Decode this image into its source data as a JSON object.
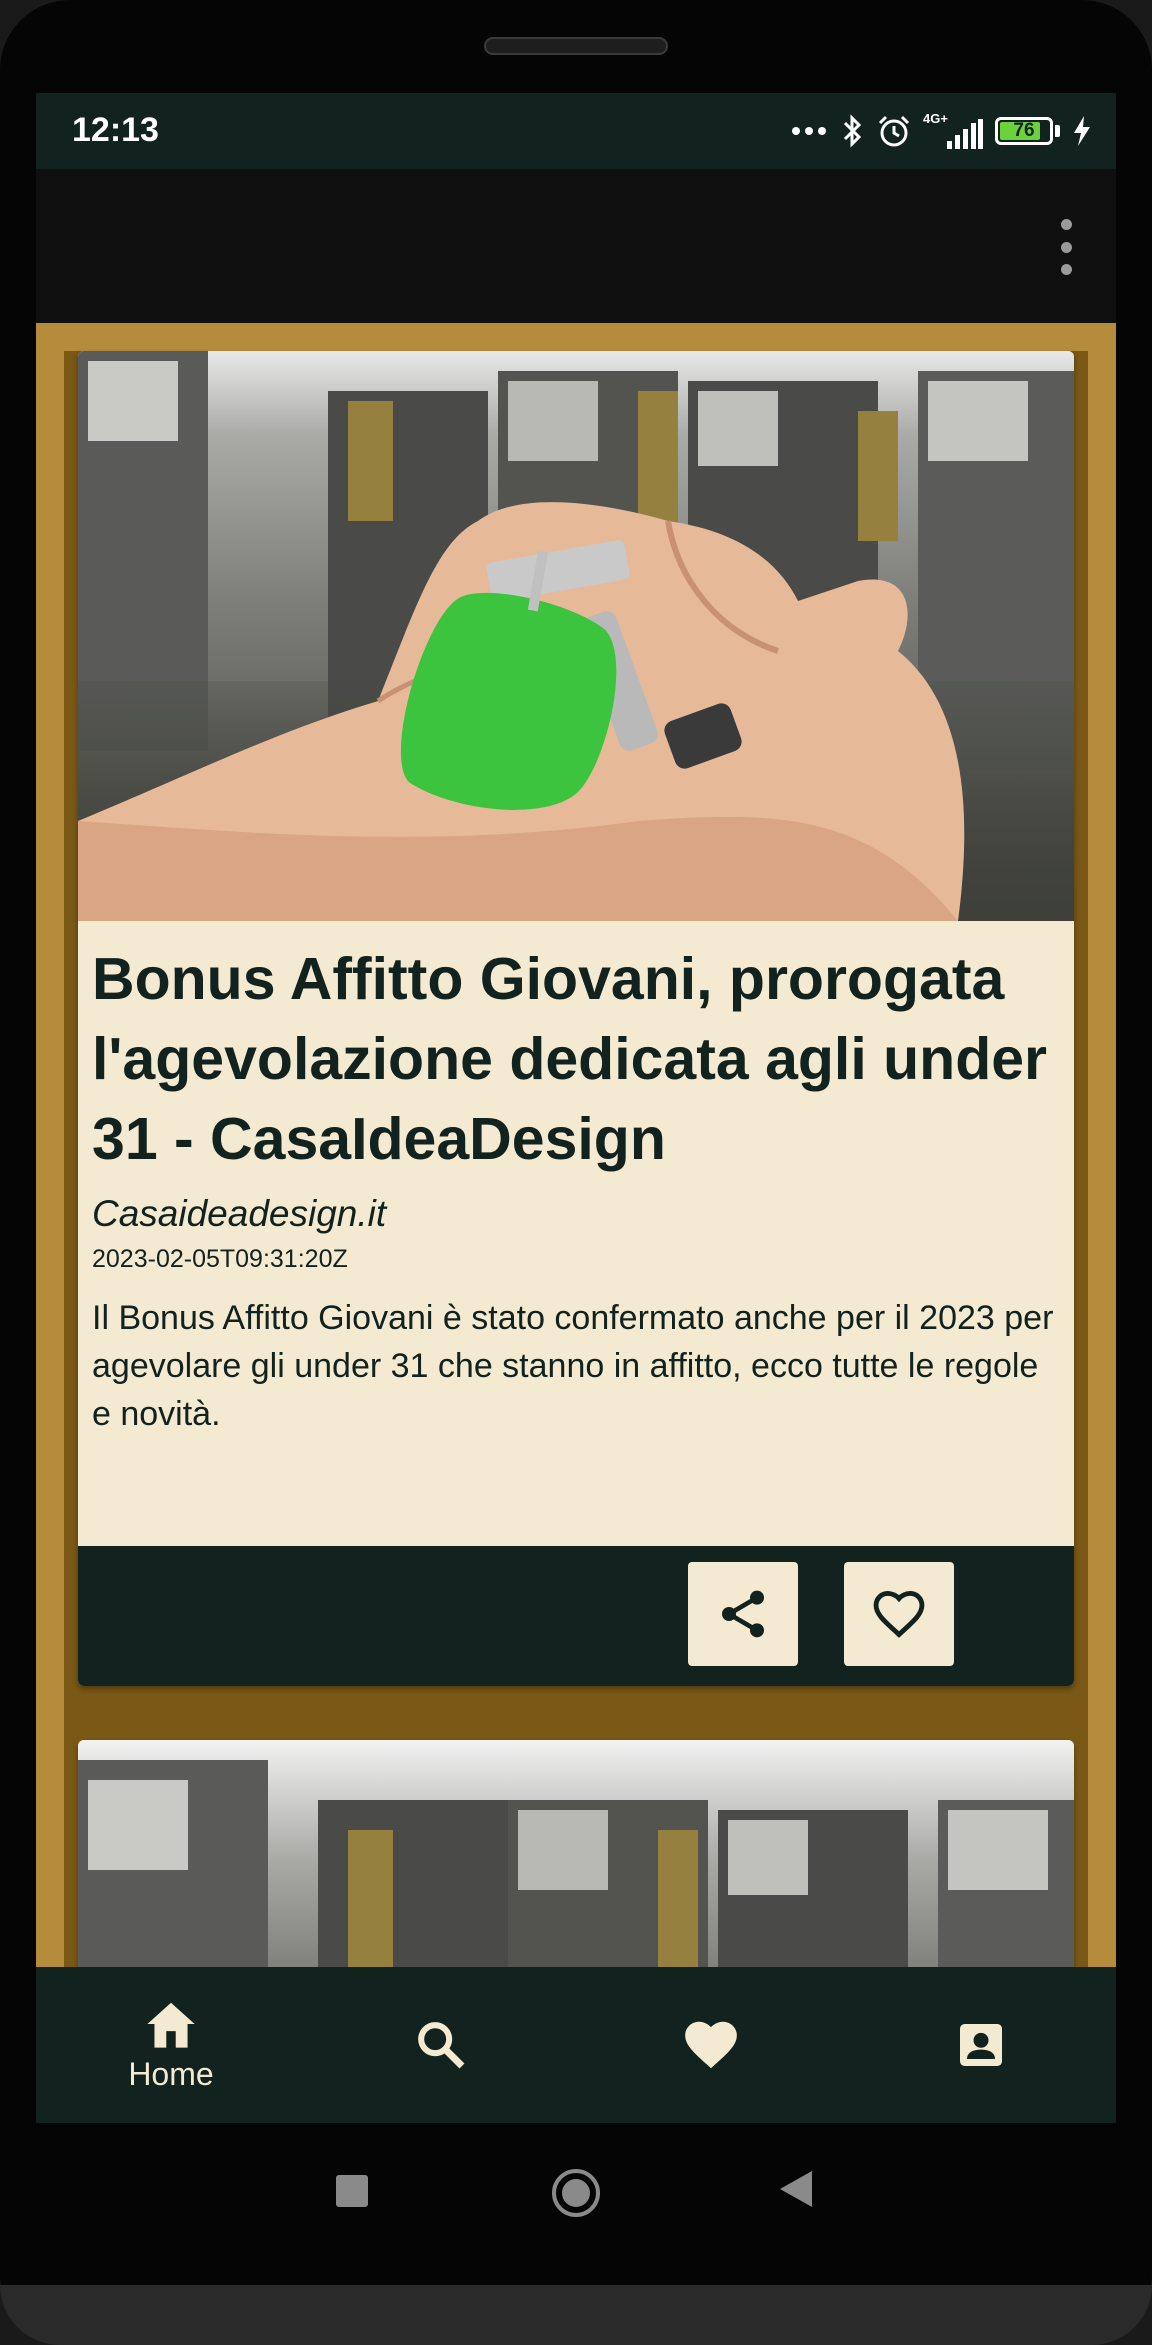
{
  "status_bar": {
    "time": "12:13",
    "network": "4G+",
    "battery_percent": "76",
    "icons": [
      "more-dots-icon",
      "bluetooth-icon",
      "alarm-icon",
      "signal-icon",
      "battery-icon",
      "charging-icon"
    ]
  },
  "app_bar": {
    "overflow_icon": "more-vertical-icon"
  },
  "articles": [
    {
      "title": "Bonus Affitto Giovani, prorogata l'agevolazione dedicata agli under 31 - CasaIdeaDesign",
      "source": "Casaideadesign.it",
      "date": "2023-02-05T09:31:20Z",
      "description": "Il Bonus Affitto Giovani è stato confermato anche per il 2023 per agevolare gli under 31 che stanno in affitto, ecco tutte le regole e novità.",
      "image": "hand holding keys in front of houses",
      "actions": [
        {
          "icon": "share-icon"
        },
        {
          "icon": "heart-outline-icon"
        }
      ]
    },
    {
      "image": "hand holding keys in front of houses"
    }
  ],
  "bottom_nav": {
    "items": [
      {
        "icon": "home-icon",
        "label": "Home",
        "selected": true
      },
      {
        "icon": "search-icon",
        "label": ""
      },
      {
        "icon": "heart-icon",
        "label": ""
      },
      {
        "icon": "account-box-icon",
        "label": ""
      }
    ]
  },
  "system_nav": {
    "icons": [
      "recents-square-icon",
      "home-circle-icon",
      "back-triangle-icon"
    ]
  },
  "colors": {
    "dark_green": "#12221e",
    "cream": "#f4e9d1",
    "gold": "#b58b3c",
    "brown": "#7a5816"
  }
}
